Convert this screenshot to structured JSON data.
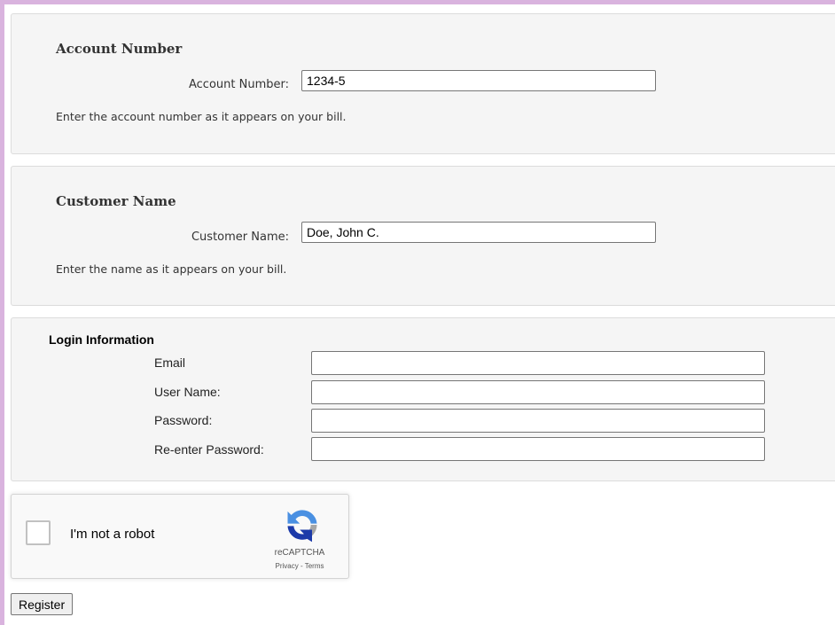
{
  "account_section": {
    "heading": "Account Number",
    "label": "Account Number:",
    "value": "1234-5",
    "help": "Enter the account number as it appears on your bill."
  },
  "customer_section": {
    "heading": "Customer Name",
    "label": "Customer Name:",
    "value": "Doe, John C.",
    "help": "Enter the name as it appears on your bill."
  },
  "login_section": {
    "heading": "Login Information",
    "fields": [
      {
        "label": "Email",
        "value": ""
      },
      {
        "label": "User Name:",
        "value": ""
      },
      {
        "label": "Password:",
        "value": ""
      },
      {
        "label": "Re-enter Password:",
        "value": ""
      }
    ]
  },
  "captcha": {
    "label": "I'm not a robot",
    "brand": "reCAPTCHA",
    "privacy": "Privacy",
    "separator": " - ",
    "terms": "Terms",
    "icon": "recaptcha-logo-icon"
  },
  "register_button": "Register",
  "colors": {
    "frame_accent": "#d9b3de",
    "panel_background": "#f5f5f5",
    "recaptcha_blue": "#4a90e2",
    "recaptcha_dark_blue": "#1c3aa9",
    "recaptcha_gray": "#a6a6a6"
  }
}
